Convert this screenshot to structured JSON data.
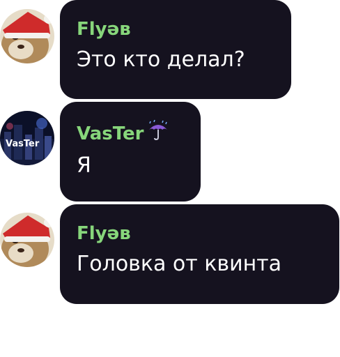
{
  "messages": [
    {
      "author": "Flyəв",
      "text": "Это кто делал?",
      "avatar_icon": "cat-santa-hat-avatar"
    },
    {
      "author": "VasTer",
      "author_badge_icon": "umbrella-with-rain-icon",
      "text": "Я",
      "avatar_label": "VasTer",
      "avatar_icon": "city-night-avatar"
    },
    {
      "author": "Flyəв",
      "text": "Головка от квинта",
      "avatar_icon": "cat-santa-hat-avatar"
    }
  ],
  "colors": {
    "bubble_bg": "#15121f",
    "author_name": "#87d67b",
    "message_text": "#ffffff"
  }
}
